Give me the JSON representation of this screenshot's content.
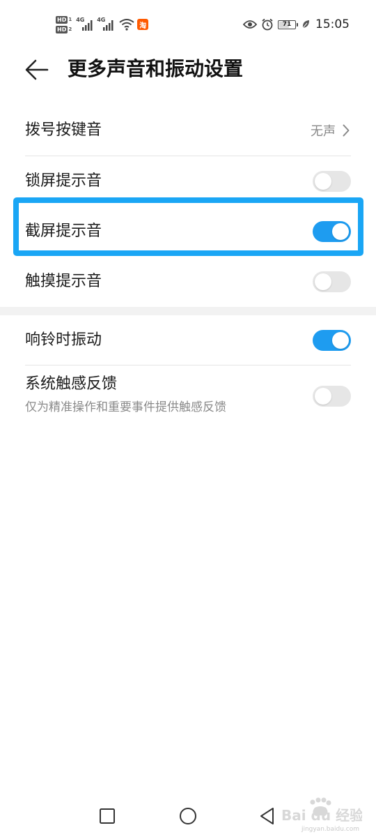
{
  "status_bar": {
    "hd1": "HD",
    "hd1_sim": "1",
    "hd2": "HD",
    "hd2_sim": "2",
    "net1": "4G",
    "net2": "4G",
    "app_badge": "淘",
    "battery": "71",
    "battery_percent": 71,
    "time": "15:05",
    "icons": [
      "signal-icon",
      "wifi-icon",
      "taobao-icon",
      "eye-icon",
      "alarm-icon",
      "battery-icon",
      "leaf-icon"
    ]
  },
  "header": {
    "title": "更多声音和振动设置"
  },
  "items": [
    {
      "label": "拨号按键音",
      "value": "无声",
      "type": "link"
    },
    {
      "label": "锁屏提示音",
      "type": "toggle",
      "on": false
    },
    {
      "label": "截屏提示音",
      "type": "toggle",
      "on": true,
      "highlighted": true
    },
    {
      "label": "触摸提示音",
      "type": "toggle",
      "on": false
    },
    {
      "label": "响铃时振动",
      "type": "toggle",
      "on": true
    },
    {
      "label": "系统触感反馈",
      "sub": "仅为精准操作和重要事件提供触感反馈",
      "type": "toggle",
      "on": false
    }
  ],
  "nav": {
    "icons": [
      "recent-apps-icon",
      "home-icon",
      "back-nav-icon"
    ]
  },
  "watermark": {
    "text": "Bai du 经验",
    "url": "jingyan.baidu.com"
  },
  "colors": {
    "accent": "#1e9cf0",
    "highlight": "#1aa6f5",
    "toggle_off": "#e6e6e6"
  }
}
